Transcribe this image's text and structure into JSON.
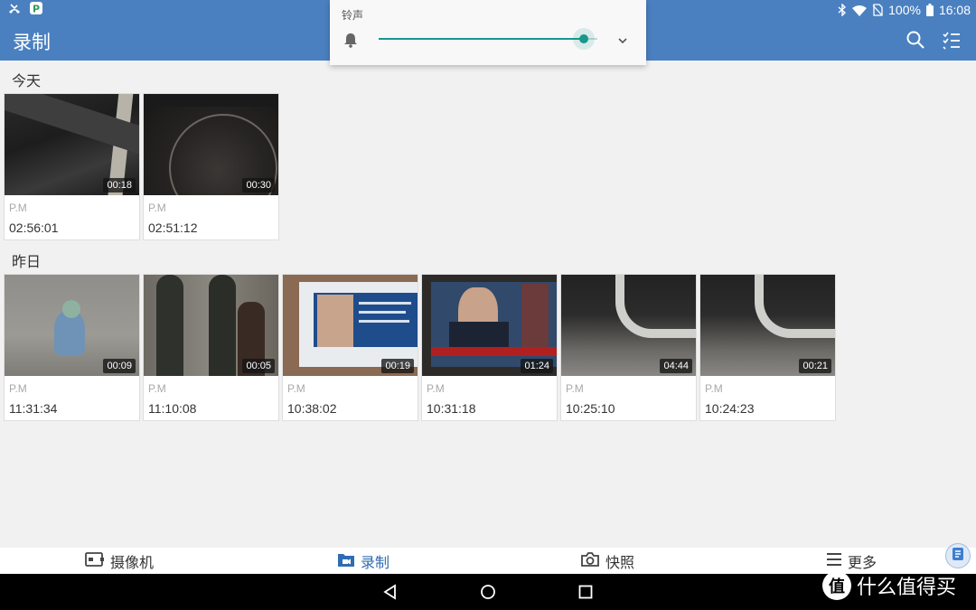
{
  "status_bar": {
    "battery": "100%",
    "clock": "16:08"
  },
  "app_bar": {
    "title": "录制"
  },
  "volume_panel": {
    "label": "铃声",
    "level": 0.94
  },
  "sections": [
    {
      "header": "今天",
      "items": [
        {
          "duration": "00:18",
          "ampm": "P.M",
          "time": "02:56:01"
        },
        {
          "duration": "00:30",
          "ampm": "P.M",
          "time": "02:51:12"
        }
      ]
    },
    {
      "header": "昨日",
      "items": [
        {
          "duration": "00:09",
          "ampm": "P.M",
          "time": "11:31:34"
        },
        {
          "duration": "00:05",
          "ampm": "P.M",
          "time": "11:10:08"
        },
        {
          "duration": "00:19",
          "ampm": "P.M",
          "time": "10:38:02"
        },
        {
          "duration": "01:24",
          "ampm": "P.M",
          "time": "10:31:18"
        },
        {
          "duration": "04:44",
          "ampm": "P.M",
          "time": "10:25:10"
        },
        {
          "duration": "00:21",
          "ampm": "P.M",
          "time": "10:24:23"
        }
      ]
    }
  ],
  "tabs": [
    {
      "label": "摄像机",
      "icon": "camcorder-icon"
    },
    {
      "label": "录制",
      "icon": "folder-video-icon"
    },
    {
      "label": "快照",
      "icon": "camera-icon"
    },
    {
      "label": "更多",
      "icon": "menu-icon"
    }
  ],
  "watermark": {
    "badge": "值",
    "text": "什么值得买"
  },
  "colors": {
    "app_bar": "#4a80c0",
    "accent_teal": "#16988b",
    "active_tab": "#2f6cb3"
  }
}
